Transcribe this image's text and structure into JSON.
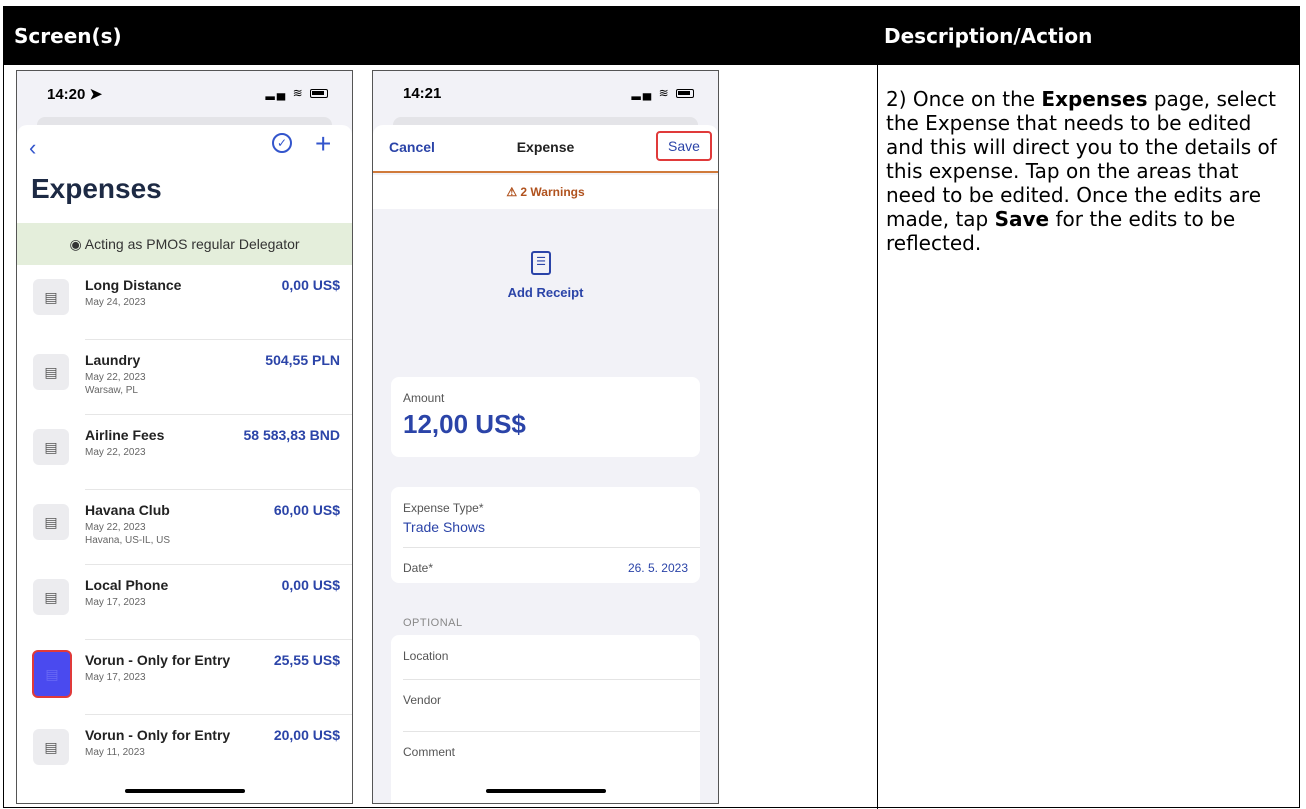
{
  "table": {
    "header_screens": "Screen(s)",
    "header_description": "Description/Action"
  },
  "description": {
    "prefix": "2) Once on the ",
    "expenses_bold": "Expenses",
    "middle": " page, select the Expense that needs to be edited and this will direct you to the details of this expense. Tap on the areas that need to be edited. Once the edits are made, tap ",
    "save_bold": "Save",
    "suffix": " for the edits to be reflected."
  },
  "phone1": {
    "time": "14:20 ➤",
    "back_label": "‹",
    "check_label": "✓",
    "add_label": "+",
    "title": "Expenses",
    "banner": "◉ Acting as PMOS regular Delegator",
    "icon_glyph": "▤",
    "items": [
      {
        "name": "Long Distance",
        "date": "May 24, 2023",
        "location": "",
        "amount": "0,00 US$"
      },
      {
        "name": "Laundry",
        "date": "May 22, 2023",
        "location": "Warsaw, PL",
        "amount": "504,55 PLN"
      },
      {
        "name": "Airline Fees",
        "date": "May 22, 2023",
        "location": "",
        "amount": "58 583,83 BND"
      },
      {
        "name": "Havana Club",
        "date": "May 22, 2023",
        "location": "Havana, US-IL, US",
        "amount": "60,00 US$"
      },
      {
        "name": "Local Phone",
        "date": "May 17, 2023",
        "location": "",
        "amount": "0,00 US$"
      },
      {
        "name": "Vorun - Only for Entry",
        "date": "May 17, 2023",
        "location": "",
        "amount": "25,55 US$"
      },
      {
        "name": "Vorun - Only for Entry",
        "date": "May 11, 2023",
        "location": "",
        "amount": "20,00 US$"
      }
    ]
  },
  "phone2": {
    "time": "14:21",
    "cancel": "Cancel",
    "title": "Expense",
    "save": "Save",
    "warnings": "⚠ 2 Warnings",
    "receipt_icon": "☰",
    "add_receipt": "Add Receipt",
    "amount_label": "Amount",
    "amount_value": "12,00 US$",
    "expense_type_label": "Expense Type*",
    "expense_type_value": "Trade Shows",
    "date_label": "Date*",
    "date_value": "26. 5. 2023",
    "optional_label": "OPTIONAL",
    "location": "Location",
    "vendor": "Vendor",
    "comment": "Comment"
  },
  "status_icons": "▂▄ ≋",
  "colors": {
    "accent": "#2b44a8",
    "warning": "#b0521e",
    "highlight_border": "#e03a3a",
    "banner_bg": "#e4eedb",
    "selected_icon": "#4a4aef"
  }
}
